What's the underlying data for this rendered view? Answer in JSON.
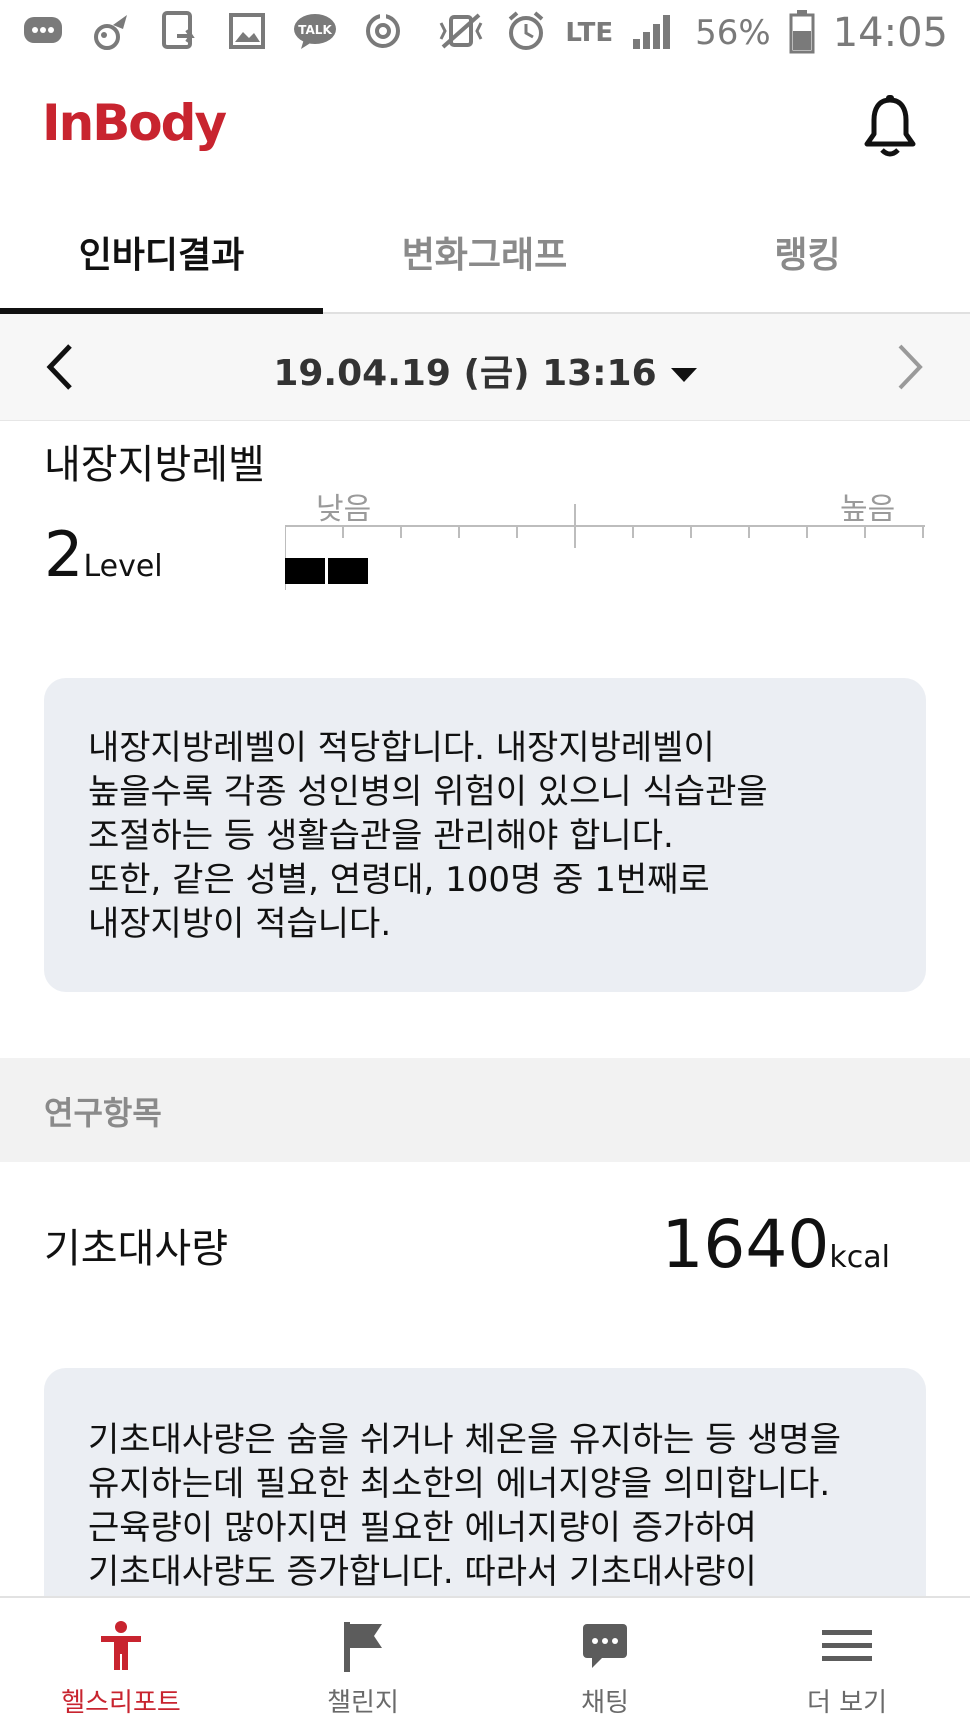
{
  "status_bar": {
    "icons_left": [
      "chat-bubble-icon",
      "game-icon",
      "screen-share-icon",
      "gallery-icon",
      "talk-icon",
      "sync-icon"
    ],
    "talk_text": "TALK",
    "network": "LTE",
    "battery": "56%",
    "time": "14:05"
  },
  "header": {
    "logo": "InBody"
  },
  "tabs": [
    {
      "label": "인바디결과",
      "active": true
    },
    {
      "label": "변화그래프",
      "active": false
    },
    {
      "label": "랭킹",
      "active": false
    }
  ],
  "date": {
    "label": "19.04.19 (금) 13:16"
  },
  "visceral": {
    "title": "내장지방레벨",
    "value": "2",
    "unit": "Level",
    "scale_low": "낮음",
    "scale_high": "높음",
    "level": 2,
    "description": "내장지방레벨이 적당합니다. 내장지방레벨이\n높을수록 각종 성인병의 위험이 있으니 식습관을\n조절하는 등 생활습관을 관리해야 합니다.\n또한, 같은 성별, 연령대, 100명 중 1번째로\n내장지방이 적습니다."
  },
  "research": {
    "label": "연구항목"
  },
  "bmr": {
    "title": "기초대사량",
    "value": "1640",
    "unit": "kcal",
    "description": "기초대사량은 숨을 쉬거나 체온을 유지하는 등 생명을\n유지하는데 필요한 최소한의 에너지양을 의미합니다.\n근육량이 많아지면 필요한 에너지량이 증가하여\n기초대사량도 증가합니다. 따라서 기초대사량이"
  },
  "bottom_nav": [
    {
      "label": "헬스리포트",
      "icon": "person-icon",
      "active": true
    },
    {
      "label": "챌린지",
      "icon": "flag-icon",
      "active": false
    },
    {
      "label": "채팅",
      "icon": "chat-icon",
      "active": false
    },
    {
      "label": "더 보기",
      "icon": "menu-icon",
      "active": false
    }
  ],
  "colors": {
    "brand": "#c8242f",
    "box_bg": "#ebeef3",
    "band_bg": "#f2f2f2"
  }
}
